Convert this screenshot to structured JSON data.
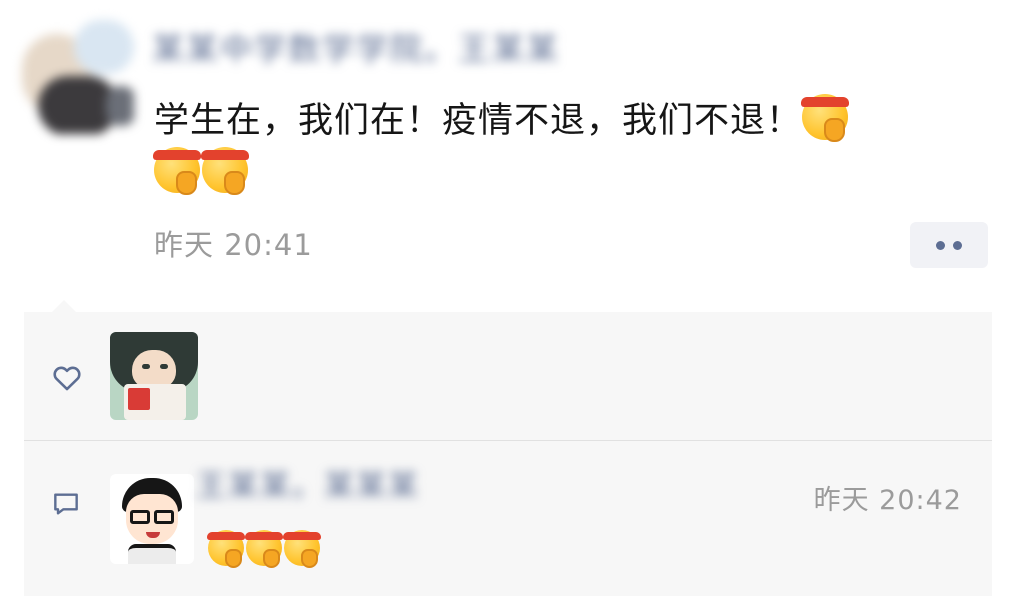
{
  "post": {
    "author": "某某中学数学学院。王某某",
    "text": "学生在，我们在！疫情不退，我们不退！",
    "emoji_count_inline": 1,
    "emoji_count_trailing": 2,
    "time": "昨天 20:41",
    "emoji_icon": "saluting-headband-face"
  },
  "likes": {
    "icon": "heart-outline-icon"
  },
  "comments": [
    {
      "author": "王某某。某某某",
      "time": "昨天 20:42",
      "emoji_count": 3
    }
  ],
  "colors": {
    "name_blue": "#5d6e93",
    "panel_bg": "#f7f7f7",
    "time_gray": "#9b9b9b"
  }
}
